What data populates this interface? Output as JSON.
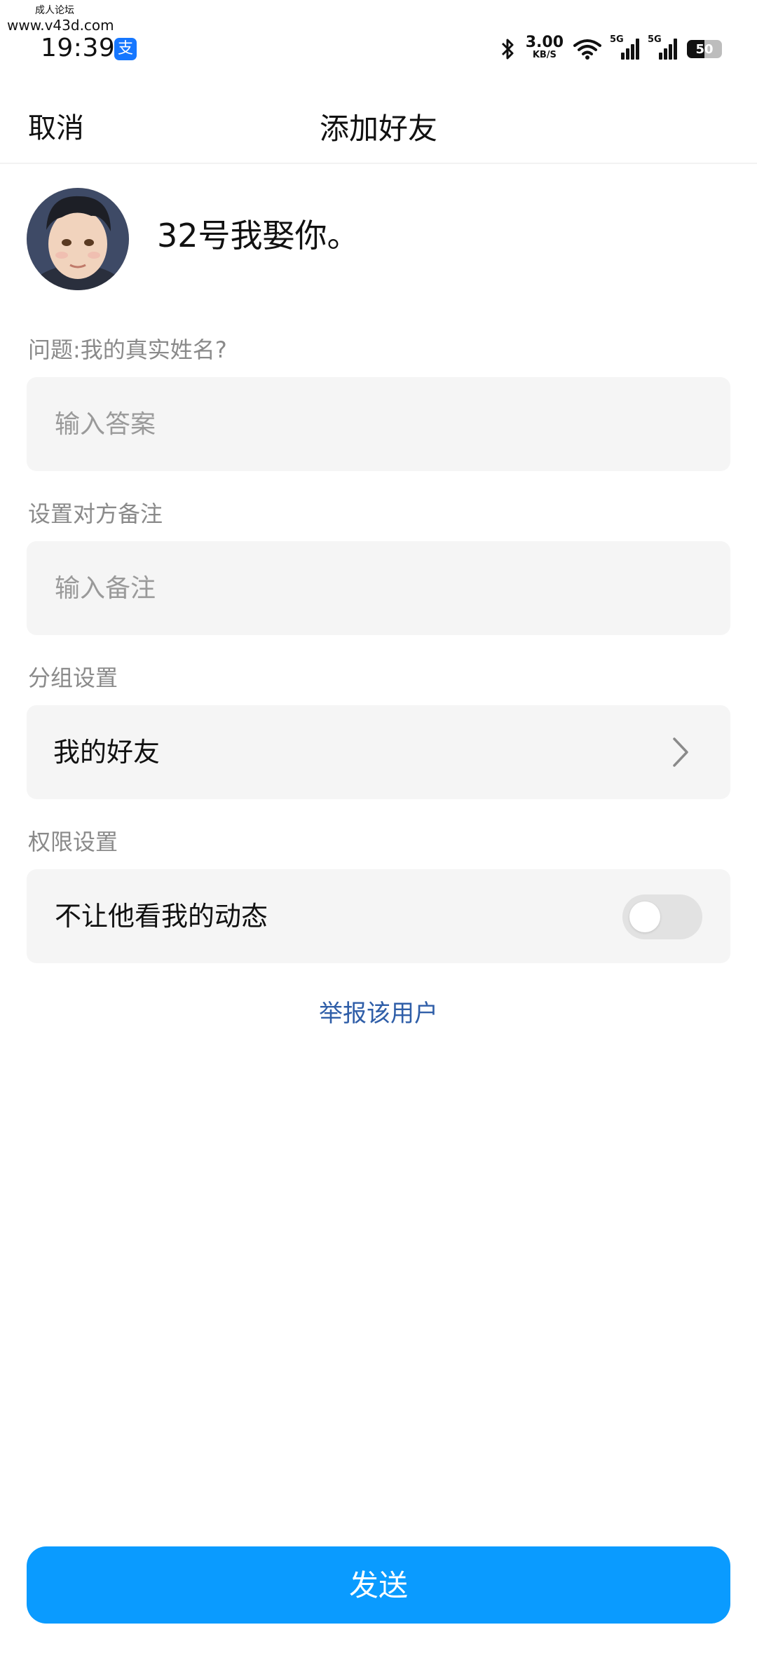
{
  "watermark": {
    "line1": "成人论坛",
    "line2": "www.v43d.com"
  },
  "status_bar": {
    "time": "19:39",
    "app_badge": "支",
    "speed_value": "3.00",
    "speed_unit": "KB/S",
    "network1": "5G",
    "network2": "5G",
    "battery": "50"
  },
  "header": {
    "cancel": "取消",
    "title": "添加好友"
  },
  "profile": {
    "nickname": "32号我娶你。"
  },
  "question": {
    "label": "问题:我的真实姓名?",
    "placeholder": "输入答案",
    "value": ""
  },
  "remark": {
    "label": "设置对方备注",
    "placeholder": "输入备注",
    "value": ""
  },
  "group": {
    "label": "分组设置",
    "value": "我的好友"
  },
  "permission": {
    "label": "权限设置",
    "item": "不让他看我的动态",
    "enabled": false
  },
  "report": "举报该用户",
  "send": "发送",
  "colors": {
    "accent": "#0a9bff",
    "link": "#2f5ea8",
    "field_bg": "#f5f5f5"
  }
}
